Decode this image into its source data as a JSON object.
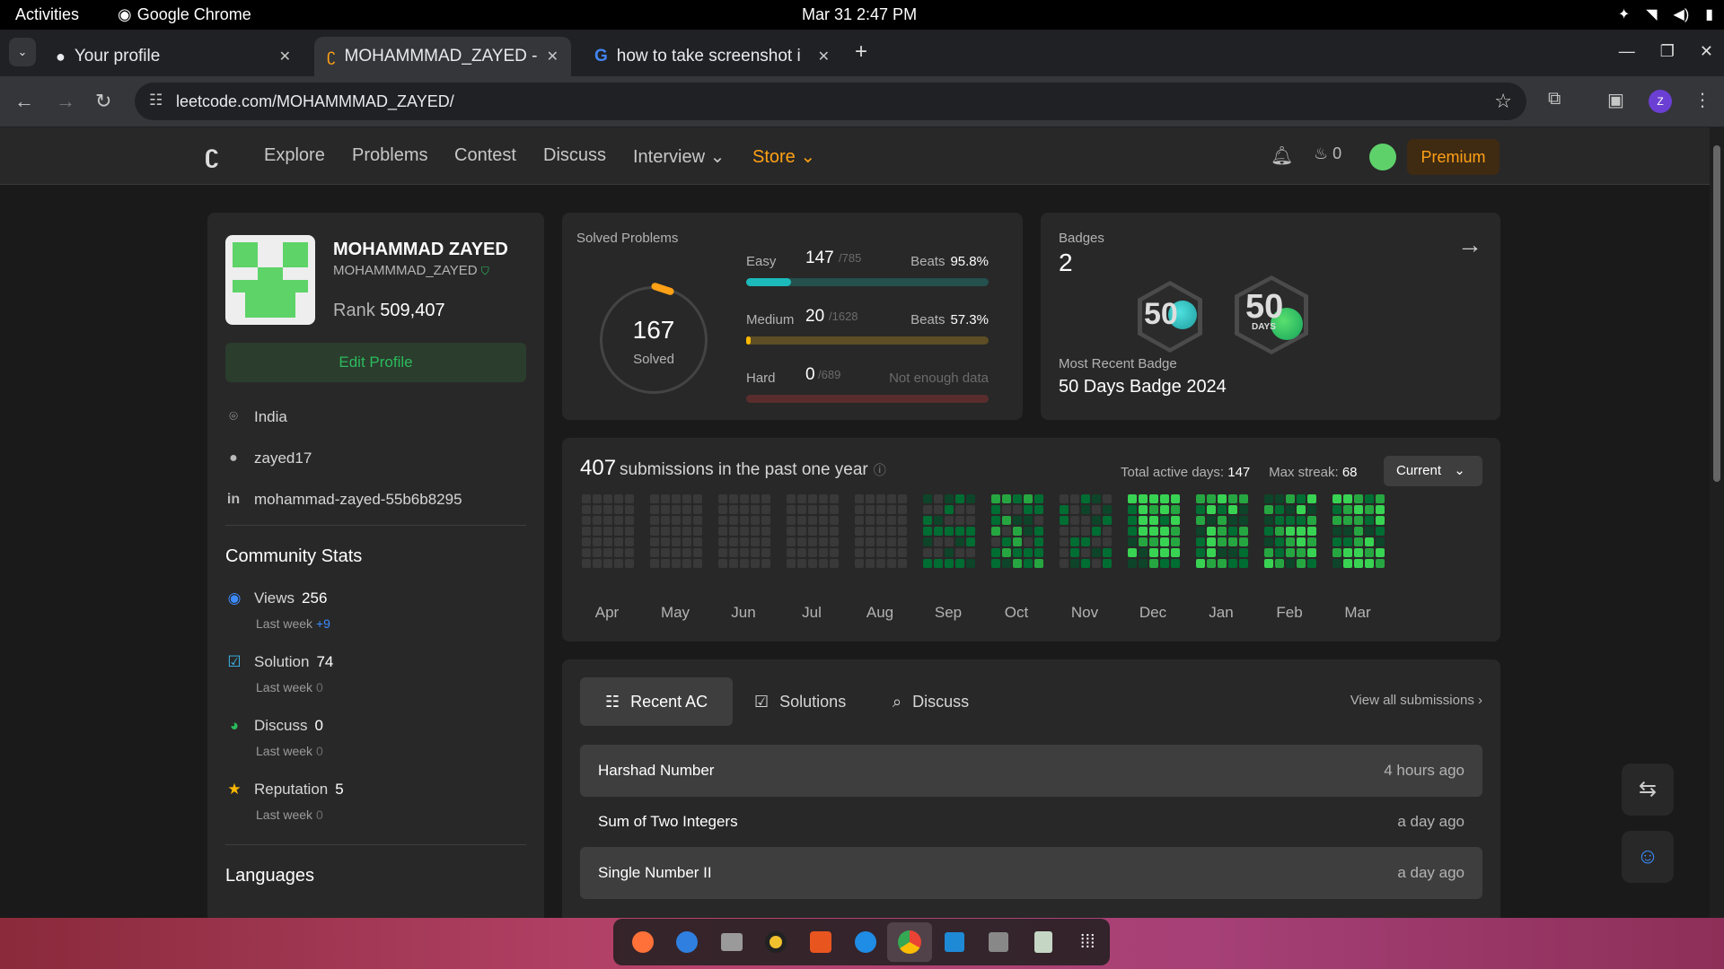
{
  "system_bar": {
    "activities": "Activities",
    "app_name": "Google Chrome",
    "clock": "Mar 31  2:47 PM"
  },
  "browser": {
    "tabs": [
      {
        "label": "Your profile",
        "icon": "github-icon"
      },
      {
        "label": "MOHAMMMAD_ZAYED -",
        "icon": "leetcode-icon"
      },
      {
        "label": "how to take screenshot i",
        "icon": "google-icon"
      }
    ],
    "url": "leetcode.com/MOHAMMMAD_ZAYED/",
    "profile_initial": "Z"
  },
  "lc_nav": {
    "items": [
      "Explore",
      "Problems",
      "Contest",
      "Discuss",
      "Interview",
      "Store"
    ],
    "streak": "0",
    "premium": "Premium"
  },
  "profile": {
    "name": "MOHAMMAD ZAYED",
    "username": "MOHAMMMAD_ZAYED",
    "rank_label": "Rank",
    "rank": "509,407",
    "edit": "Edit Profile",
    "location": "India",
    "github": "zayed17",
    "linkedin": "mohammad-zayed-55b6b8295",
    "community_title": "Community Stats",
    "stats": [
      {
        "label": "Views",
        "value": "256",
        "sub": "Last week",
        "delta": "+9",
        "color": "#3d8bfd"
      },
      {
        "label": "Solution",
        "value": "74",
        "sub": "Last week",
        "delta": "0",
        "color": "#3dbbf2"
      },
      {
        "label": "Discuss",
        "value": "0",
        "sub": "Last week",
        "delta": "0",
        "color": "#2cbb5d"
      },
      {
        "label": "Reputation",
        "value": "5",
        "sub": "Last week",
        "delta": "0",
        "color": "#ffb800"
      }
    ],
    "languages_title": "Languages"
  },
  "solved": {
    "title": "Solved Problems",
    "total": "167",
    "total_label": "Solved",
    "difficulties": [
      {
        "name": "Easy",
        "count": "147",
        "total": "/785",
        "beats_label": "Beats",
        "beats": "95.8%",
        "fraction": 0.187,
        "color": "#1cbaba",
        "track": "#24504d"
      },
      {
        "name": "Medium",
        "count": "20",
        "total": "/1628",
        "beats_label": "Beats",
        "beats": "57.3%",
        "fraction": 0.012,
        "color": "#ffb800",
        "track": "#5e4e25"
      },
      {
        "name": "Hard",
        "count": "0",
        "total": "/689",
        "beats_label": "",
        "beats": "Not enough data",
        "fraction": 0,
        "color": "#f63737",
        "track": "#5a2d2d"
      }
    ]
  },
  "badges": {
    "title": "Badges",
    "count": "2",
    "recent_label": "Most Recent Badge",
    "recent": "50 Days Badge 2024",
    "badge_text": [
      "50",
      "DAYS"
    ]
  },
  "heatmap": {
    "count": "407",
    "title": "submissions in the past one year",
    "active_label": "Total active days:",
    "active": "147",
    "streak_label": "Max streak:",
    "streak": "68",
    "selector": "Current",
    "months": [
      "Apr",
      "May",
      "Jun",
      "Jul",
      "Aug",
      "Sep",
      "Oct",
      "Nov",
      "Dec",
      "Jan",
      "Feb",
      "Mar"
    ]
  },
  "recent": {
    "tabs": [
      "Recent AC",
      "Solutions",
      "Discuss"
    ],
    "view_all": "View all submissions",
    "rows": [
      {
        "title": "Harshad Number",
        "time": "4 hours ago"
      },
      {
        "title": "Sum of Two Integers",
        "time": "a day ago"
      },
      {
        "title": "Single Number II",
        "time": "a day ago"
      }
    ]
  },
  "colors": {
    "accent_orange": "#ffa116",
    "green": "#2cbb5d",
    "heat_levels": [
      "#393939",
      "#0e4429",
      "#006d32",
      "#26a641",
      "#39d353"
    ]
  }
}
